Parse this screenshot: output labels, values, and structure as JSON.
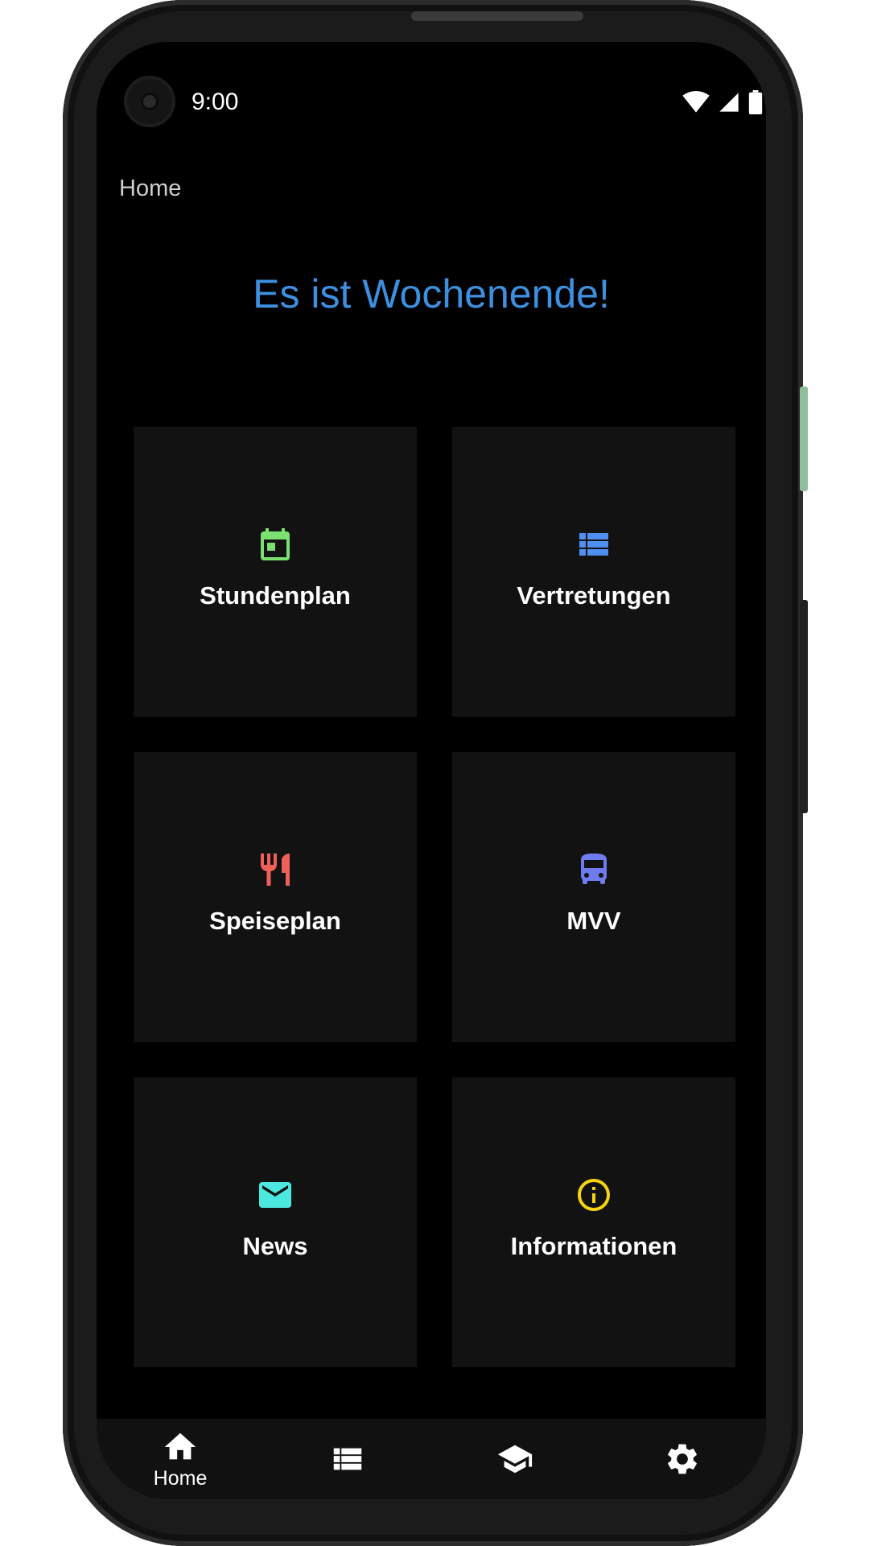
{
  "status_bar": {
    "time": "9:00",
    "icons": [
      "wifi-icon",
      "signal-icon",
      "battery-icon"
    ]
  },
  "app_bar": {
    "title": "Home"
  },
  "headline": "Es ist Wochenende!",
  "colors": {
    "headline": "#3d8fe0",
    "stundenplan": "#7be06f",
    "vertretungen": "#4f8ff0",
    "speiseplan": "#f0605a",
    "mvv": "#6f7cf0",
    "news": "#4be8e0",
    "informationen": "#f5d311"
  },
  "tiles": [
    {
      "label": "Stundenplan",
      "icon": "calendar-icon"
    },
    {
      "label": "Vertretungen",
      "icon": "list-icon"
    },
    {
      "label": "Speiseplan",
      "icon": "restaurant-icon"
    },
    {
      "label": "MVV",
      "icon": "bus-icon"
    },
    {
      "label": "News",
      "icon": "mail-icon"
    },
    {
      "label": "Informationen",
      "icon": "info-icon"
    }
  ],
  "bottom_nav": {
    "items": [
      {
        "label": "Home",
        "icon": "home-icon",
        "selected": true
      },
      {
        "icon": "list-icon"
      },
      {
        "icon": "school-icon"
      },
      {
        "icon": "settings-icon"
      }
    ]
  }
}
